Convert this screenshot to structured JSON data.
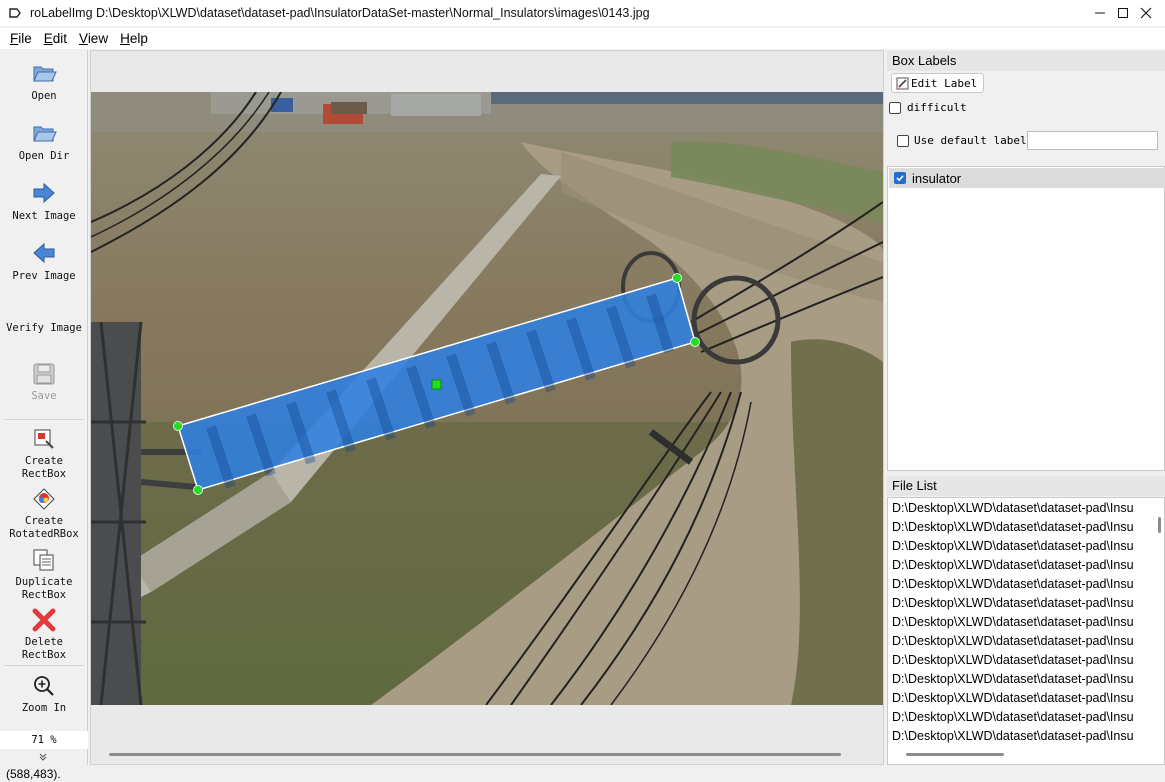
{
  "window": {
    "title": "roLabelImg D:\\Desktop\\XLWD\\dataset\\dataset-pad\\InsulatorDataSet-master\\Normal_Insulators\\images\\0143.jpg",
    "controls": [
      "minimize-icon",
      "maximize-icon",
      "close-icon"
    ]
  },
  "menu": {
    "items": [
      {
        "label": "File",
        "mnemonic": "F"
      },
      {
        "label": "Edit",
        "mnemonic": "E"
      },
      {
        "label": "View",
        "mnemonic": "V"
      },
      {
        "label": "Help",
        "mnemonic": "H"
      }
    ]
  },
  "toolbar": {
    "open": "Open",
    "open_dir": "Open Dir",
    "next_image": "Next Image",
    "prev_image": "Prev Image",
    "verify_image": "Verify Image",
    "save": "Save",
    "create_rectbox_1": "Create",
    "create_rectbox_2": "RectBox",
    "create_rotated_1": "Create",
    "create_rotated_2": "RotatedRBox",
    "duplicate_1": "Duplicate",
    "duplicate_2": "RectBox",
    "delete_1": "Delete",
    "delete_2": "RectBox",
    "zoom_in": "Zoom In",
    "zoom_value": "71 %"
  },
  "box_labels": {
    "title": "Box Labels",
    "edit_label": "Edit Label",
    "difficult": "difficult",
    "use_default_label": "Use default label",
    "default_label_value": "",
    "labels": [
      {
        "name": "insulator",
        "checked": true
      }
    ]
  },
  "file_list": {
    "title": "File List",
    "items": [
      "D:\\Desktop\\XLWD\\dataset\\dataset-pad\\Insu",
      "D:\\Desktop\\XLWD\\dataset\\dataset-pad\\Insu",
      "D:\\Desktop\\XLWD\\dataset\\dataset-pad\\Insu",
      "D:\\Desktop\\XLWD\\dataset\\dataset-pad\\Insu",
      "D:\\Desktop\\XLWD\\dataset\\dataset-pad\\Insu",
      "D:\\Desktop\\XLWD\\dataset\\dataset-pad\\Insu",
      "D:\\Desktop\\XLWD\\dataset\\dataset-pad\\Insu",
      "D:\\Desktop\\XLWD\\dataset\\dataset-pad\\Insu",
      "D:\\Desktop\\XLWD\\dataset\\dataset-pad\\Insu",
      "D:\\Desktop\\XLWD\\dataset\\dataset-pad\\Insu",
      "D:\\Desktop\\XLWD\\dataset\\dataset-pad\\Insu",
      "D:\\Desktop\\XLWD\\dataset\\dataset-pad\\Insu",
      "D:\\Desktop\\XLWD\\dataset\\dataset-pad\\Insu"
    ]
  },
  "status": {
    "cursor": "(588,483)."
  },
  "colors": {
    "annotation_fill": "#2f7fe0",
    "annotation_vertex": "#22dd22",
    "accent": "#1f6fd1"
  }
}
